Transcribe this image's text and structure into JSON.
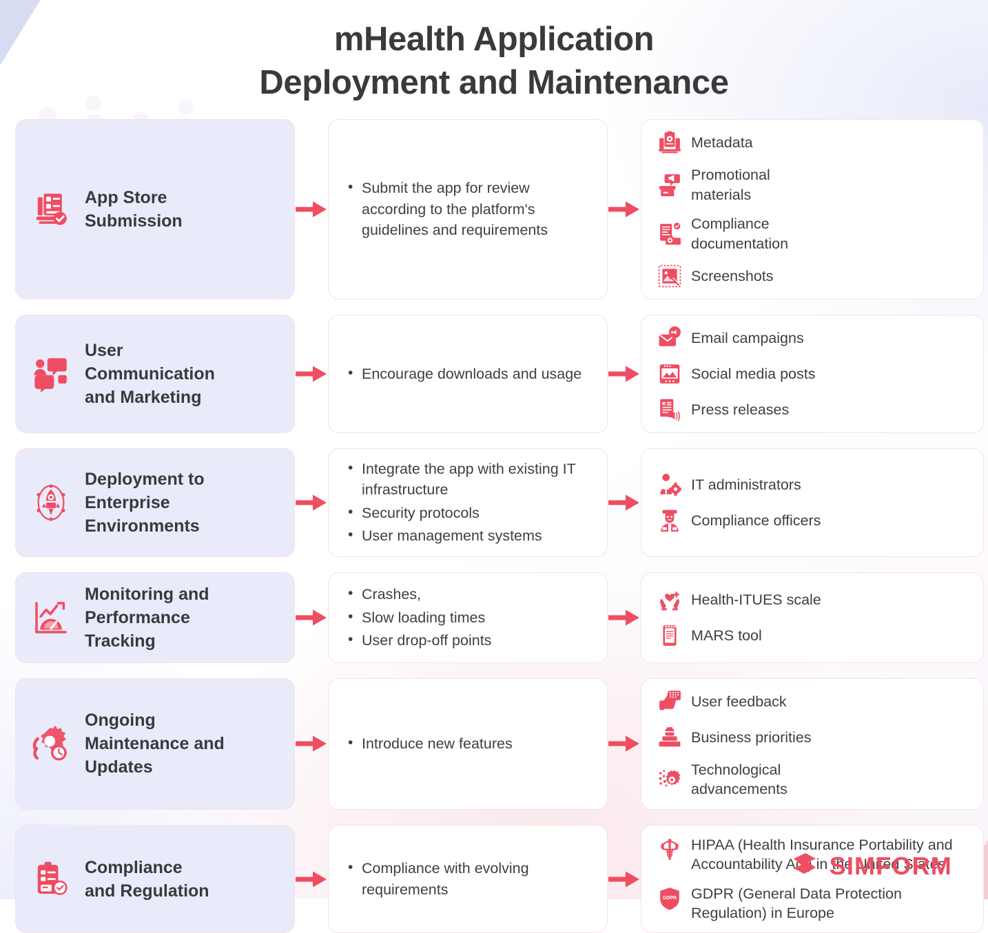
{
  "title_line1": "mHealth Application",
  "title_line2": "Deployment and Maintenance",
  "colors": {
    "accent": "#ef4d62",
    "accent_dark": "#e8415a",
    "stage_box_bg": "#e9ebfb",
    "box_border": "#fadfe4",
    "text": "#3a3a3c",
    "body_text": "#3f3f41",
    "corner_tl": "#d7dcf3",
    "corner_br": "#f6ccd4"
  },
  "rows": [
    {
      "stage": {
        "label": "App Store\nSubmission",
        "icon": "checklist-document-icon"
      },
      "actions": [
        "Submit the app for review according to the platform's guidelines and requirements"
      ],
      "items": [
        {
          "label": "Metadata",
          "icon": "metadata-server-icon",
          "span": "half"
        },
        {
          "label": "Promotional materials",
          "icon": "megaphone-box-icon",
          "span": "half"
        },
        {
          "label": "Compliance documentation",
          "icon": "compliance-docs-icon",
          "span": "half"
        },
        {
          "label": "Screenshots",
          "icon": "screenshot-image-icon",
          "span": "half"
        }
      ]
    },
    {
      "stage": {
        "label": "User\nCommunication\nand Marketing",
        "icon": "people-speech-icon"
      },
      "actions": [
        "Encourage downloads and usage"
      ],
      "items": [
        {
          "label": "Email campaigns",
          "icon": "email-megaphone-icon",
          "span": "half"
        },
        {
          "label": "Social media posts",
          "icon": "social-media-post-icon",
          "span": "half"
        },
        {
          "label": "Press releases",
          "icon": "press-release-icon",
          "span": "half"
        }
      ]
    },
    {
      "stage": {
        "label": "Deployment to\nEnterprise\nEnvironments",
        "icon": "rocket-launch-icon"
      },
      "actions": [
        "Integrate the app with existing IT infrastructure",
        "Security protocols",
        "User management systems"
      ],
      "items": [
        {
          "label": "IT administrators",
          "icon": "it-admin-icon",
          "span": "full"
        },
        {
          "label": "Compliance officers",
          "icon": "compliance-officer-icon",
          "span": "full"
        }
      ]
    },
    {
      "stage": {
        "label": "Monitoring and\nPerformance\nTracking",
        "icon": "performance-gauge-chart-icon"
      },
      "actions": [
        "Crashes,",
        "Slow loading times",
        "User drop-off points"
      ],
      "items": [
        {
          "label": "Health-ITUES scale",
          "icon": "heart-hands-icon",
          "span": "full"
        },
        {
          "label": "MARS tool",
          "icon": "mobile-rating-icon",
          "span": "full"
        }
      ]
    },
    {
      "stage": {
        "label": "Ongoing\nMaintenance and\nUpdates",
        "icon": "gear-clock-icon"
      },
      "actions": [
        "Introduce new features"
      ],
      "items": [
        {
          "label": "User feedback",
          "icon": "thumbs-up-feedback-icon",
          "span": "half"
        },
        {
          "label": "Business priorities",
          "icon": "briefcase-priority-icon",
          "span": "half"
        },
        {
          "label": "Technological advancements",
          "icon": "tech-gear-pixel-icon",
          "span": "half"
        }
      ]
    },
    {
      "stage": {
        "label": "Compliance\nand Regulation",
        "icon": "clipboard-check-icon"
      },
      "actions": [
        "Compliance with evolving requirements"
      ],
      "items": [
        {
          "label": "HIPAA (Health Insurance Portability and Accountability Act) in the United States",
          "icon": "caduceus-icon",
          "span": "full"
        },
        {
          "label": "GDPR (General Data Protection Regulation) in Europe",
          "icon": "gdpr-shield-icon",
          "span": "full"
        }
      ]
    }
  ],
  "footer": {
    "brand": "SIMFORM",
    "logo_icon": "simform-logo-icon"
  }
}
